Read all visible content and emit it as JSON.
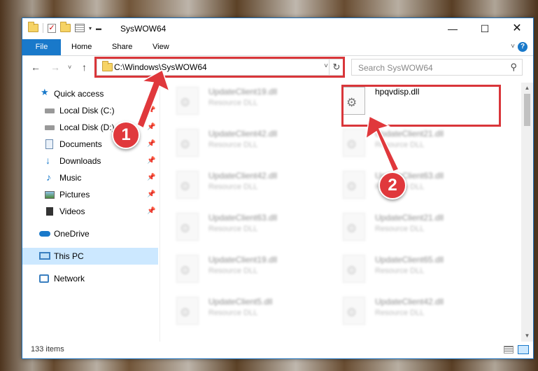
{
  "window": {
    "title": "SysWOW64"
  },
  "ribbon": {
    "tabs": [
      "File",
      "Home",
      "Share",
      "View"
    ],
    "help": "?"
  },
  "navigation": {
    "address_path": "C:\\Windows\\SysWOW64",
    "search_placeholder": "Search SysWOW64"
  },
  "sidebar": {
    "items": [
      {
        "label": "Quick access",
        "icon": "star-icon"
      },
      {
        "label": "Local Disk (C:)",
        "icon": "drive-icon",
        "pinned": true
      },
      {
        "label": "Local Disk (D:)",
        "icon": "drive-icon",
        "pinned": true
      },
      {
        "label": "Documents",
        "icon": "documents-icon",
        "pinned": true
      },
      {
        "label": "Downloads",
        "icon": "download-icon",
        "pinned": true
      },
      {
        "label": "Music",
        "icon": "music-icon",
        "pinned": true
      },
      {
        "label": "Pictures",
        "icon": "pictures-icon",
        "pinned": true
      },
      {
        "label": "Videos",
        "icon": "videos-icon",
        "pinned": true
      },
      {
        "label": "OneDrive",
        "icon": "cloud-icon"
      },
      {
        "label": "This PC",
        "icon": "computer-icon",
        "selected": true
      },
      {
        "label": "Network",
        "icon": "network-icon"
      }
    ]
  },
  "files": [
    {
      "name": "UpdateClient19.dll",
      "type": "Resource DLL"
    },
    {
      "name": "hpqvdisp.dll",
      "type": ""
    },
    {
      "name": "UpdateClient42.dll",
      "type": "Resource DLL"
    },
    {
      "name": "UpdateClient21.dll",
      "type": "Resource DLL"
    },
    {
      "name": "UpdateClient42.dll",
      "type": "Resource DLL"
    },
    {
      "name": "UpdateClient63.dll",
      "type": "Resource DLL"
    },
    {
      "name": "UpdateClient63.dll",
      "type": "Resource DLL"
    },
    {
      "name": "UpdateClient21.dll",
      "type": "Resource DLL"
    },
    {
      "name": "UpdateClient19.dll",
      "type": "Resource DLL"
    },
    {
      "name": "UpdateClient65.dll",
      "type": "Resource DLL"
    },
    {
      "name": "UpdateClient5.dll",
      "type": "Resource DLL"
    },
    {
      "name": "UpdateClient42.dll",
      "type": "Resource DLL"
    }
  ],
  "status": {
    "item_count": "133 items"
  },
  "callouts": [
    "1",
    "2"
  ],
  "colors": {
    "accent": "#1979ca",
    "highlight": "#d9363a",
    "selection": "#cce8ff"
  }
}
